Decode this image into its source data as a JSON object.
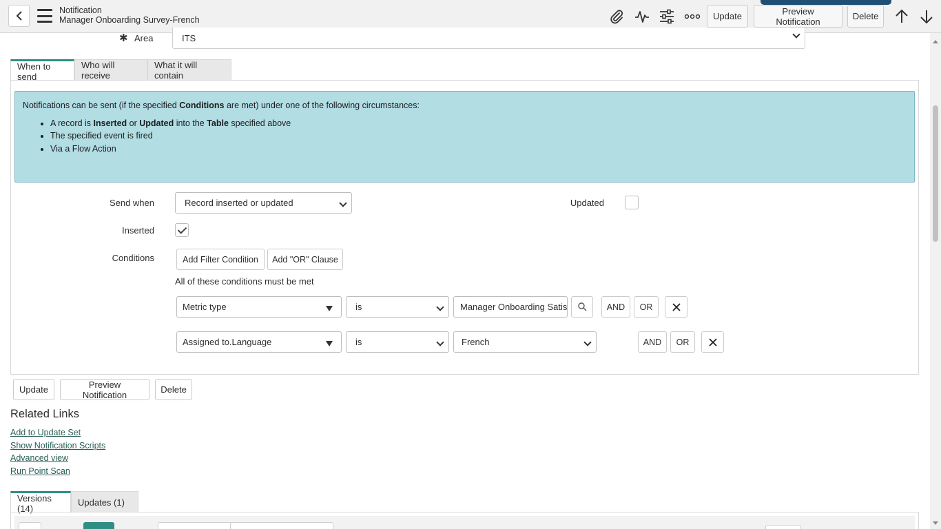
{
  "header": {
    "record_type": "Notification",
    "record_name": "Manager Onboarding Survey-French",
    "buttons": {
      "update": "Update",
      "preview": "Preview Notification",
      "delete": "Delete"
    },
    "icons": [
      "back-icon",
      "menu-icon",
      "attachment-icon",
      "activity-icon",
      "settings-icon",
      "more-icon",
      "arrow-up-icon",
      "arrow-down-icon"
    ]
  },
  "area": {
    "label": "Area",
    "value": "ITS"
  },
  "tabs": [
    {
      "label": "When to send",
      "active": true
    },
    {
      "label": "Who will receive",
      "active": false
    },
    {
      "label": "What it will contain",
      "active": false
    }
  ],
  "info": {
    "intro_1": "Notifications can be sent (if the specified ",
    "intro_bold": "Conditions",
    "intro_2": " are met) under one of the following circumstances:",
    "item1": {
      "a": "A record is ",
      "b1": "Inserted",
      "c": " or ",
      "b2": "Updated",
      "d": " into the ",
      "b3": "Table",
      "e": " specified above"
    },
    "item2": "The specified event is fired",
    "item3": "Via a Flow Action"
  },
  "form": {
    "send_when": {
      "label": "Send when",
      "value": "Record inserted or updated"
    },
    "updated": {
      "label": "Updated",
      "checked": false
    },
    "inserted": {
      "label": "Inserted",
      "checked": true
    },
    "conditions": {
      "label": "Conditions",
      "add_filter": "Add Filter Condition",
      "add_or": "Add \"OR\" Clause",
      "all_met": "All of these conditions must be met",
      "rows": [
        {
          "field": "Metric type",
          "operator": "is",
          "value": "Manager Onboarding Satisf",
          "and": "AND",
          "or": "OR"
        },
        {
          "field": "Assigned to.Language",
          "operator": "is",
          "value": "French",
          "and": "AND",
          "or": "OR"
        }
      ]
    }
  },
  "footer_buttons": {
    "update": "Update",
    "preview": "Preview Notification",
    "delete": "Delete"
  },
  "related_links": {
    "title": "Related Links",
    "links": [
      "Add to Update Set",
      "Show Notification Scripts",
      "Advanced view",
      "Run Point Scan"
    ]
  },
  "bottom_tabs": [
    "Versions (14)",
    "Updates (1)"
  ],
  "colors": {
    "accent": "#2f8f84",
    "info_bg": "#b1dde3",
    "header_bg": "#f1f1f1",
    "top_strip": "#1f4f75"
  }
}
